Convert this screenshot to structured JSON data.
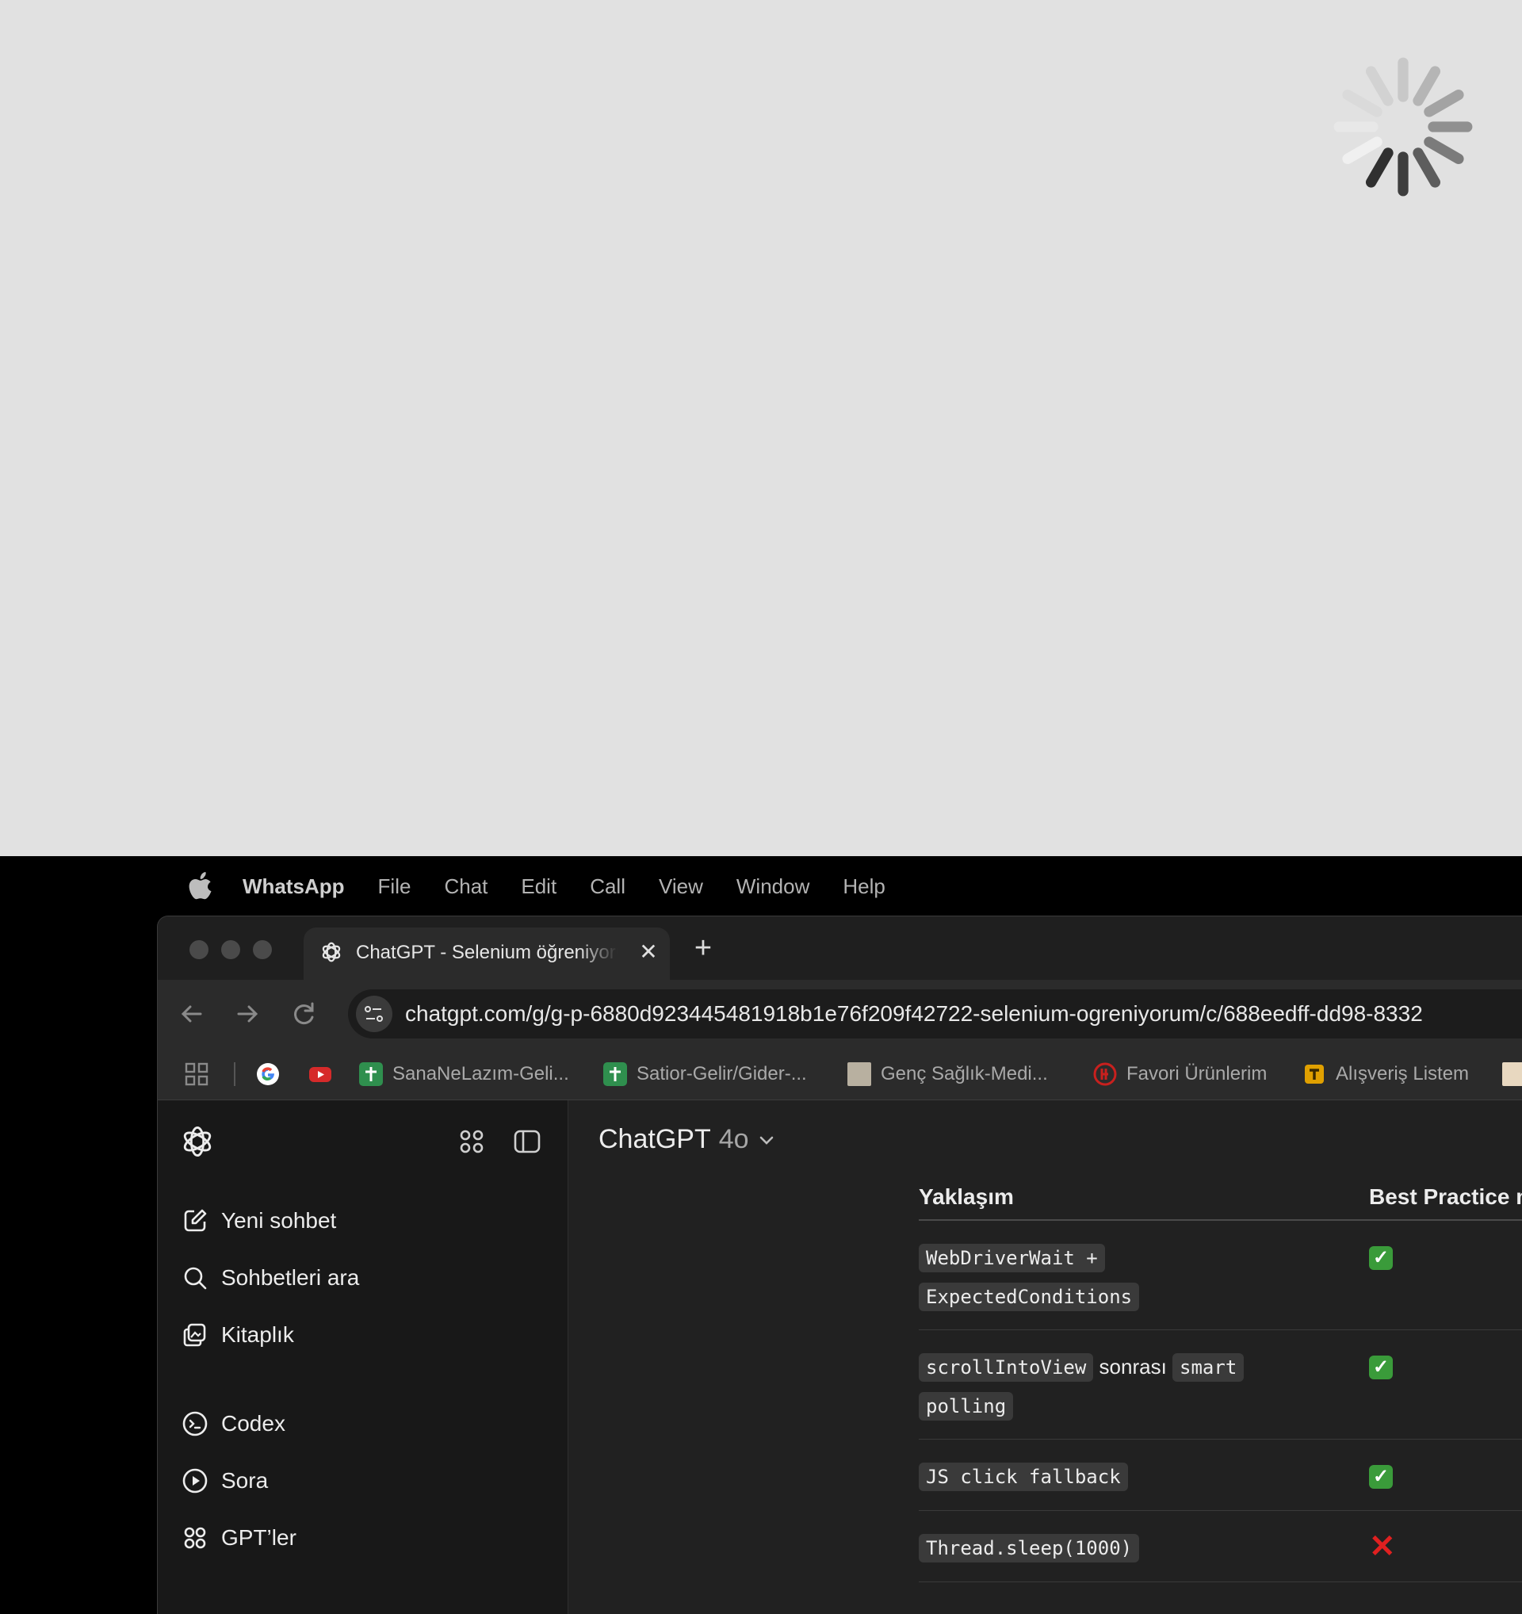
{
  "menubar": {
    "app_name": "WhatsApp",
    "items": [
      "File",
      "Chat",
      "Edit",
      "Call",
      "View",
      "Window",
      "Help"
    ]
  },
  "browser": {
    "tab_title": "ChatGPT - Selenium öğreniyorum",
    "url": "chatgpt.com/g/g-p-6880d923445481918b1e76f209f42722-selenium-ogreniyorum/c/688eedff-dd98-8332",
    "bookmarks": [
      {
        "label": "",
        "icon": "google-icon",
        "color": "#ffffff"
      },
      {
        "label": "",
        "icon": "youtube-icon",
        "color": "#d62a2a"
      },
      {
        "label": "SanaNeLazım-Geli...",
        "icon": "sheets-icon",
        "color": "#2f8f4e"
      },
      {
        "label": "Satior-Gelir/Gider-...",
        "icon": "sheets-icon",
        "color": "#2f8f4e"
      },
      {
        "label": "Genç Sağlık-Medi...",
        "icon": "image-icon",
        "color": "#b8b0a0"
      },
      {
        "label": "Favori Ürünlerim",
        "icon": "brand-icon",
        "color": "#c8201e"
      },
      {
        "label": "Alışveriş Listem",
        "icon": "t-icon",
        "color": "#e0a000"
      }
    ]
  },
  "sidebar": {
    "items": [
      {
        "label": "Yeni sohbet",
        "icon": "edit-icon"
      },
      {
        "label": "Sohbetleri ara",
        "icon": "search-icon"
      },
      {
        "label": "Kitaplık",
        "icon": "library-icon"
      },
      {
        "label": "Codex",
        "icon": "codex-icon"
      },
      {
        "label": "Sora",
        "icon": "play-icon"
      },
      {
        "label": "GPT’ler",
        "icon": "grid-icon"
      }
    ]
  },
  "main": {
    "model_name": "ChatGPT",
    "model_version": "4o",
    "table": {
      "headers": [
        "Yaklaşım",
        "Best Practice m"
      ],
      "rows": [
        {
          "code1": "WebDriverWait +",
          "code2": "ExpectedConditions",
          "text": "",
          "result": "check"
        },
        {
          "code1": "scrollIntoView",
          "text": "sonrası",
          "code2": "smart",
          "code3": "polling",
          "result": "check"
        },
        {
          "code1": "JS click fallback",
          "result": "check"
        },
        {
          "code1": "Thread.sleep(1000)",
          "result": "cross"
        }
      ]
    }
  }
}
